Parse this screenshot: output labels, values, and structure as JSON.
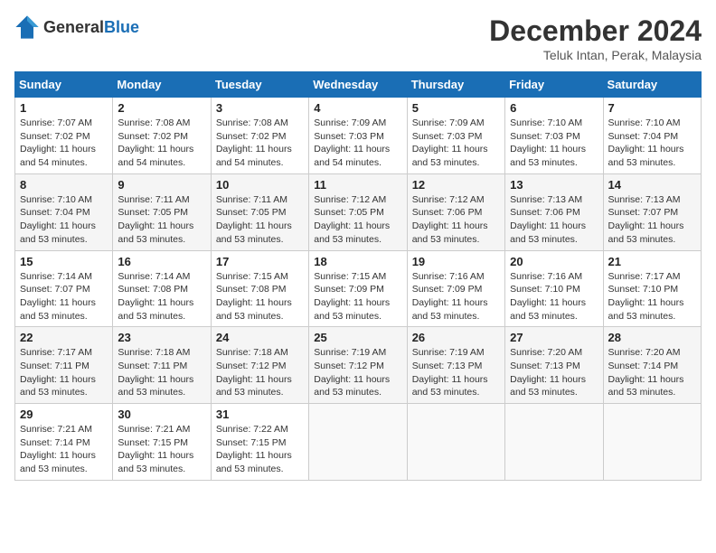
{
  "logo": {
    "general": "General",
    "blue": "Blue"
  },
  "title": {
    "month_year": "December 2024",
    "location": "Teluk Intan, Perak, Malaysia"
  },
  "headers": [
    "Sunday",
    "Monday",
    "Tuesday",
    "Wednesday",
    "Thursday",
    "Friday",
    "Saturday"
  ],
  "weeks": [
    [
      {
        "day": "1",
        "detail": "Sunrise: 7:07 AM\nSunset: 7:02 PM\nDaylight: 11 hours\nand 54 minutes."
      },
      {
        "day": "2",
        "detail": "Sunrise: 7:08 AM\nSunset: 7:02 PM\nDaylight: 11 hours\nand 54 minutes."
      },
      {
        "day": "3",
        "detail": "Sunrise: 7:08 AM\nSunset: 7:02 PM\nDaylight: 11 hours\nand 54 minutes."
      },
      {
        "day": "4",
        "detail": "Sunrise: 7:09 AM\nSunset: 7:03 PM\nDaylight: 11 hours\nand 54 minutes."
      },
      {
        "day": "5",
        "detail": "Sunrise: 7:09 AM\nSunset: 7:03 PM\nDaylight: 11 hours\nand 53 minutes."
      },
      {
        "day": "6",
        "detail": "Sunrise: 7:10 AM\nSunset: 7:03 PM\nDaylight: 11 hours\nand 53 minutes."
      },
      {
        "day": "7",
        "detail": "Sunrise: 7:10 AM\nSunset: 7:04 PM\nDaylight: 11 hours\nand 53 minutes."
      }
    ],
    [
      {
        "day": "8",
        "detail": "Sunrise: 7:10 AM\nSunset: 7:04 PM\nDaylight: 11 hours\nand 53 minutes."
      },
      {
        "day": "9",
        "detail": "Sunrise: 7:11 AM\nSunset: 7:05 PM\nDaylight: 11 hours\nand 53 minutes."
      },
      {
        "day": "10",
        "detail": "Sunrise: 7:11 AM\nSunset: 7:05 PM\nDaylight: 11 hours\nand 53 minutes."
      },
      {
        "day": "11",
        "detail": "Sunrise: 7:12 AM\nSunset: 7:05 PM\nDaylight: 11 hours\nand 53 minutes."
      },
      {
        "day": "12",
        "detail": "Sunrise: 7:12 AM\nSunset: 7:06 PM\nDaylight: 11 hours\nand 53 minutes."
      },
      {
        "day": "13",
        "detail": "Sunrise: 7:13 AM\nSunset: 7:06 PM\nDaylight: 11 hours\nand 53 minutes."
      },
      {
        "day": "14",
        "detail": "Sunrise: 7:13 AM\nSunset: 7:07 PM\nDaylight: 11 hours\nand 53 minutes."
      }
    ],
    [
      {
        "day": "15",
        "detail": "Sunrise: 7:14 AM\nSunset: 7:07 PM\nDaylight: 11 hours\nand 53 minutes."
      },
      {
        "day": "16",
        "detail": "Sunrise: 7:14 AM\nSunset: 7:08 PM\nDaylight: 11 hours\nand 53 minutes."
      },
      {
        "day": "17",
        "detail": "Sunrise: 7:15 AM\nSunset: 7:08 PM\nDaylight: 11 hours\nand 53 minutes."
      },
      {
        "day": "18",
        "detail": "Sunrise: 7:15 AM\nSunset: 7:09 PM\nDaylight: 11 hours\nand 53 minutes."
      },
      {
        "day": "19",
        "detail": "Sunrise: 7:16 AM\nSunset: 7:09 PM\nDaylight: 11 hours\nand 53 minutes."
      },
      {
        "day": "20",
        "detail": "Sunrise: 7:16 AM\nSunset: 7:10 PM\nDaylight: 11 hours\nand 53 minutes."
      },
      {
        "day": "21",
        "detail": "Sunrise: 7:17 AM\nSunset: 7:10 PM\nDaylight: 11 hours\nand 53 minutes."
      }
    ],
    [
      {
        "day": "22",
        "detail": "Sunrise: 7:17 AM\nSunset: 7:11 PM\nDaylight: 11 hours\nand 53 minutes."
      },
      {
        "day": "23",
        "detail": "Sunrise: 7:18 AM\nSunset: 7:11 PM\nDaylight: 11 hours\nand 53 minutes."
      },
      {
        "day": "24",
        "detail": "Sunrise: 7:18 AM\nSunset: 7:12 PM\nDaylight: 11 hours\nand 53 minutes."
      },
      {
        "day": "25",
        "detail": "Sunrise: 7:19 AM\nSunset: 7:12 PM\nDaylight: 11 hours\nand 53 minutes."
      },
      {
        "day": "26",
        "detail": "Sunrise: 7:19 AM\nSunset: 7:13 PM\nDaylight: 11 hours\nand 53 minutes."
      },
      {
        "day": "27",
        "detail": "Sunrise: 7:20 AM\nSunset: 7:13 PM\nDaylight: 11 hours\nand 53 minutes."
      },
      {
        "day": "28",
        "detail": "Sunrise: 7:20 AM\nSunset: 7:14 PM\nDaylight: 11 hours\nand 53 minutes."
      }
    ],
    [
      {
        "day": "29",
        "detail": "Sunrise: 7:21 AM\nSunset: 7:14 PM\nDaylight: 11 hours\nand 53 minutes."
      },
      {
        "day": "30",
        "detail": "Sunrise: 7:21 AM\nSunset: 7:15 PM\nDaylight: 11 hours\nand 53 minutes."
      },
      {
        "day": "31",
        "detail": "Sunrise: 7:22 AM\nSunset: 7:15 PM\nDaylight: 11 hours\nand 53 minutes."
      },
      {
        "day": "",
        "detail": ""
      },
      {
        "day": "",
        "detail": ""
      },
      {
        "day": "",
        "detail": ""
      },
      {
        "day": "",
        "detail": ""
      }
    ]
  ]
}
